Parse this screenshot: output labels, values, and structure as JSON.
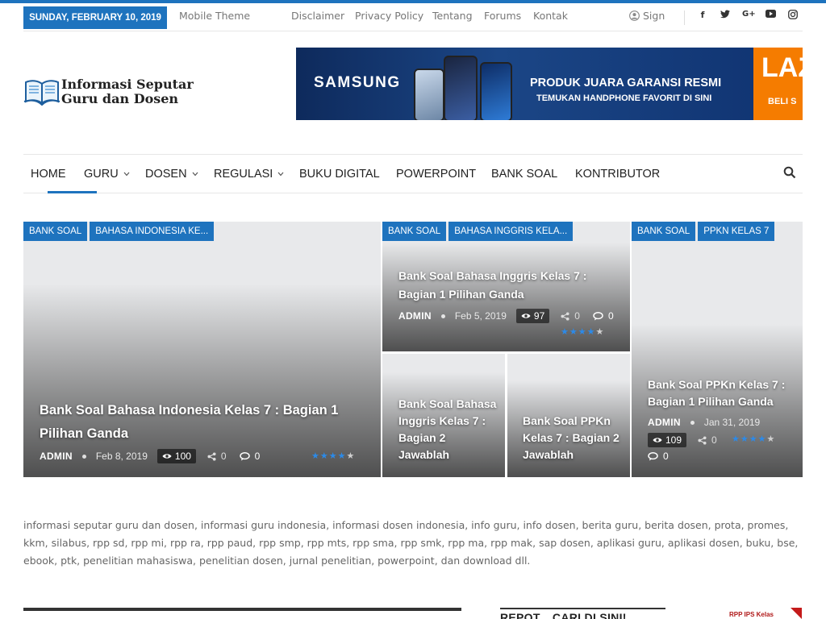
{
  "topbar": {
    "date": "SUNDAY, FEBRUARY 10, 2019",
    "links": [
      "Mobile Theme",
      "Disclaimer",
      "Privacy Policy",
      "Tentang",
      "Forums",
      "Kontak"
    ],
    "sign_label": "Sign",
    "social_icons": [
      "facebook-icon",
      "twitter-icon",
      "google-plus-icon",
      "youtube-icon",
      "instagram-icon"
    ]
  },
  "logo": {
    "line1": "Informasi Seputar",
    "line2": "Guru dan Dosen"
  },
  "ad_banner": {
    "brand": "SAMSUNG",
    "headline": "PRODUK JUARA GARANSI RESMI",
    "subline": "TEMUKAN HANDPHONE FAVORIT DI SINI",
    "partner": "LAZ",
    "cta": "BELI S"
  },
  "nav": {
    "items": [
      {
        "label": "HOME",
        "dropdown": false
      },
      {
        "label": "GURU",
        "dropdown": true
      },
      {
        "label": "DOSEN",
        "dropdown": true
      },
      {
        "label": "REGULASI",
        "dropdown": true
      },
      {
        "label": "BUKU DIGITAL",
        "dropdown": false
      },
      {
        "label": "POWERPOINT",
        "dropdown": false
      },
      {
        "label": "BANK SOAL",
        "dropdown": false
      },
      {
        "label": "KONTRIBUTOR",
        "dropdown": false
      }
    ],
    "active": "HOME"
  },
  "featured": [
    {
      "tags": [
        "BANK SOAL",
        "BAHASA INDONESIA KE..."
      ],
      "title": "Bank Soal Bahasa Indonesia Kelas 7 : Bagian 1 Pilihan Ganda",
      "author": "ADMIN",
      "date": "Feb 8, 2019",
      "views": "100",
      "shares": "0",
      "comments": "0",
      "rating": 4
    },
    {
      "tags": [
        "BANK SOAL",
        "BAHASA INGGRIS KELA..."
      ],
      "title": "Bank Soal Bahasa Inggris Kelas 7 : Bagian 1 Pilihan Ganda",
      "author": "ADMIN",
      "date": "Feb 5, 2019",
      "views": "97",
      "shares": "0",
      "comments": "0",
      "rating": 4
    },
    {
      "title": "Bank Soal Bahasa Inggris Kelas 7 : Bagian 2 Jawablah"
    },
    {
      "title": "Bank Soal PPKn Kelas 7 : Bagian 2 Jawablah"
    },
    {
      "tags": [
        "BANK SOAL",
        "PPKN KELAS 7"
      ],
      "title": "Bank Soal PPKn Kelas 7 : Bagian 1 Pilihan Ganda",
      "author": "ADMIN",
      "date": "Jan 31, 2019",
      "views": "109",
      "shares": "0",
      "comments": "0",
      "rating": 4
    }
  ],
  "description": "informasi seputar guru dan dosen, informasi guru indonesia, informasi dosen indonesia, info guru, info dosen, berita guru, berita dosen, prota, promes, kkm, silabus, rpp sd, rpp mi, rpp ra, rpp paud, rpp smp, rpp mts, rpp sma, rpp smk, rpp ma, rpp mak, sap dosen, aplikasi guru, aplikasi dosen, buku, bse, ebook, ptk, penelitian mahasiswa, penelitian dosen, jurnal penelitian, powerpoint, dan download dll.",
  "sidebar": {
    "heading": "REPOT... CARI DI SINI!",
    "ad_text": "RPP IPS Kelas"
  },
  "colors": {
    "accent": "#1e73be",
    "star": "#2c8ae8"
  }
}
